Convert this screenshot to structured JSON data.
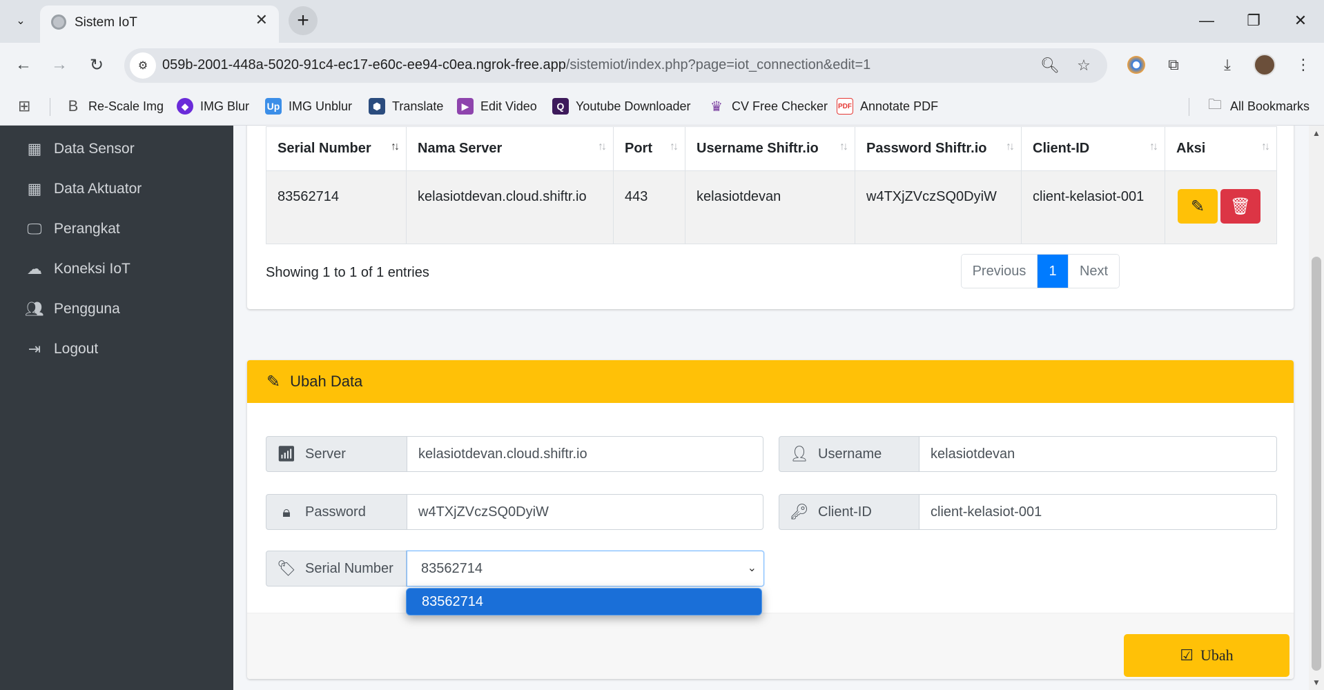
{
  "browser": {
    "tab_title": "Sistem IoT",
    "url_host": "059b-2001-448a-5020-91c4-ec17-e60c-ee94-c0ea.ngrok-free.app",
    "url_path": "/sistemiot/index.php?page=iot_connection&edit=1",
    "bookmarks": [
      {
        "label": "Re-Scale Img",
        "icon": "rescale-icon",
        "color": "#555555"
      },
      {
        "label": "IMG Blur",
        "icon": "imgblur-icon",
        "color": "#6a2bd9"
      },
      {
        "label": "IMG Unblur",
        "icon": "imgunblur-icon",
        "color": "#3b8ee8"
      },
      {
        "label": "Translate",
        "icon": "translate-icon",
        "color": "#2b4c7e"
      },
      {
        "label": "Edit Video",
        "icon": "editvideo-icon",
        "color": "#8e44ad"
      },
      {
        "label": "Youtube Downloader",
        "icon": "youtube-downloader-icon",
        "color": "#3d1a5b"
      },
      {
        "label": "CV Free Checker",
        "icon": "cv-checker-icon",
        "color": "#7b3fa0"
      },
      {
        "label": "Annotate PDF",
        "icon": "pdf-icon",
        "color": "#e53935"
      }
    ],
    "all_bookmarks": "All Bookmarks"
  },
  "sidebar": {
    "items": [
      {
        "label": "Data Sensor",
        "icon": "grid-icon"
      },
      {
        "label": "Data Aktuator",
        "icon": "grid-icon"
      },
      {
        "label": "Perangkat",
        "icon": "monitor-icon"
      },
      {
        "label": "Koneksi IoT",
        "icon": "cloud-icon"
      },
      {
        "label": "Pengguna",
        "icon": "users-icon"
      },
      {
        "label": "Logout",
        "icon": "logout-icon"
      }
    ]
  },
  "table": {
    "headers": [
      "Serial Number",
      "Nama Server",
      "Port",
      "Username Shiftr.io",
      "Password Shiftr.io",
      "Client-ID",
      "Aksi"
    ],
    "rows": [
      [
        "83562714",
        "kelasiotdevan.cloud.shiftr.io",
        "443",
        "kelasiotdevan",
        "w4TXjZVczSQ0DyiW",
        "client-kelasiot-001"
      ]
    ],
    "showing": "Showing 1 to 1 of 1 entries",
    "pagination": {
      "previous": "Previous",
      "current": "1",
      "next": "Next"
    }
  },
  "form": {
    "title": "Ubah Data",
    "server_label": "Server",
    "server_value": "kelasiotdevan.cloud.shiftr.io",
    "username_label": "Username",
    "username_value": "kelasiotdevan",
    "password_label": "Password",
    "password_value": "w4TXjZVczSQ0DyiW",
    "clientid_label": "Client-ID",
    "clientid_value": "client-kelasiot-001",
    "serial_label": "Serial Number",
    "serial_value": "83562714",
    "serial_options": [
      "83562714"
    ],
    "submit_label": "Ubah"
  },
  "colors": {
    "sidebar_bg": "#343a40",
    "accent_yellow": "#ffc107",
    "danger": "#dc3545",
    "primary": "#007bff"
  }
}
